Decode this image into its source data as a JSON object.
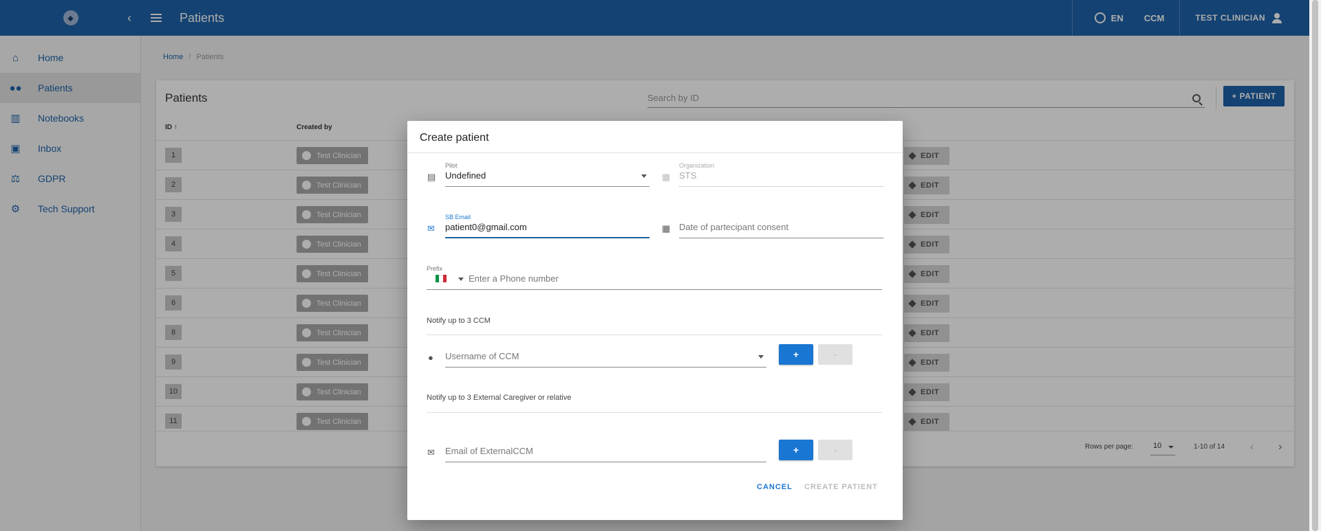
{
  "appbar": {
    "title": "Patients",
    "lang": "EN",
    "role": "CCM",
    "user": "TEST CLINICIAN"
  },
  "sidebar": {
    "items": [
      {
        "label": "Home",
        "icon": "home-icon"
      },
      {
        "label": "Patients",
        "icon": "people-icon"
      },
      {
        "label": "Notebooks",
        "icon": "bar-chart-icon"
      },
      {
        "label": "Inbox",
        "icon": "inbox-icon"
      },
      {
        "label": "GDPR",
        "icon": "gavel-icon"
      },
      {
        "label": "Tech Support",
        "icon": "support-icon"
      }
    ]
  },
  "breadcrumb": {
    "home": "Home",
    "current": "Patients"
  },
  "patients_card": {
    "title": "Patients",
    "search_placeholder": "Search by ID",
    "add_button": "+ PATIENT",
    "col_id": "ID",
    "col_created_by": "Created by",
    "edit_label": "EDIT",
    "rows": [
      {
        "id": "1",
        "created_by": "Test Clinician"
      },
      {
        "id": "2",
        "created_by": "Test Clinician"
      },
      {
        "id": "3",
        "created_by": "Test Clinician"
      },
      {
        "id": "4",
        "created_by": "Test Clinician"
      },
      {
        "id": "5",
        "created_by": "Test Clinician"
      },
      {
        "id": "6",
        "created_by": "Test Clinician"
      },
      {
        "id": "8",
        "created_by": "Test Clinician"
      },
      {
        "id": "9",
        "created_by": "Test Clinician"
      },
      {
        "id": "10",
        "created_by": "Test Clinician"
      },
      {
        "id": "11",
        "created_by": "Test Clinician"
      }
    ],
    "rows_per_page_label": "Rows per page:",
    "rows_per_page": "10",
    "range": "1-10 of 14"
  },
  "dialog": {
    "title": "Create patient",
    "pilot_label": "Pilot",
    "pilot_value": "Undefined",
    "organization_label": "Organization",
    "organization_value": "STS",
    "email_label": "SB Email",
    "email_value": "patient0@gmail.com",
    "consent_placeholder": "Date of partecipant consent",
    "prefix_label": "Prefix",
    "phone_placeholder": "Enter a Phone number",
    "notify_ccm_label": "Notify up to 3 CCM",
    "ccm_placeholder": "Username of CCM",
    "notify_external_label": "Notify up to 3 External Caregiver or relative",
    "external_placeholder": "Email of ExternalCCM",
    "add": "+",
    "remove": "-",
    "cancel": "CANCEL",
    "create": "CREATE PATIENT"
  },
  "colors": {
    "primary": "#1e62a8",
    "accent_button": "#1976d2"
  }
}
